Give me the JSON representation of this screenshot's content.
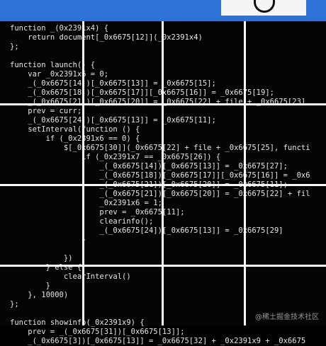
{
  "code_lines": [
    "function _(0x2391x4) {",
    "    return document[_0x6675[12]](_0x2391x4)",
    "};",
    "",
    "function launch() {",
    "    var _0x2391x6 = 0;",
    "    _(_0x6675[14])[_0x6675[13]] = _0x6675[15];",
    "    _(_0x6675[18])[_0x6675[17]][_0x6675[16]] = _0x6675[19];",
    "    _(_0x6675[21])[_0x6675[20]] = _0x6675[22] + file + _0x6675[23]",
    "    prev = curr;",
    "    _(_0x6675[24])[_0x6675[13]] = _0x6675[11];",
    "    setInterval(function () {",
    "        if (_0x2391x6 == 0) {",
    "            $[_0x6675[30]](_0x6675[22] + file + _0x6675[25], functi",
    "                if (_0x2391x7 == _0x6675[26]) {",
    "                    _(_0x6675[14])[_0x6675[13]] = _0x6675[27];",
    "                    _(_0x6675[18])[_0x6675[17]][_0x6675[16]] = _0x6",
    "                    _(_0x6675[21])[_0x6675[20]] = _0x6675[11];",
    "                    _(_0x6675[21])[_0x6675[20]] = _0x6675[22] + fil",
    "                    _0x2391x6 = 1;",
    "                    prev = _0x6675[11];",
    "                    clearinfo();",
    "                    _(_0x6675[24])[_0x6675[13]] = _0x6675[29]",
    "                }",
    "",
    "            })",
    "        } else {",
    "            clearInterval()",
    "        }",
    "    }, 10000)",
    "};",
    "",
    "function showinfo(_0x2391x9) {",
    "    prev = _(_0x6675[31])[_0x6675[13]];",
    "    _(_0x6675[3])[_0x6675[13]] = _0x6675[32] + _0x2391x9 + _0x6675"
  ],
  "watermark": "@稀土掘金技术社区"
}
